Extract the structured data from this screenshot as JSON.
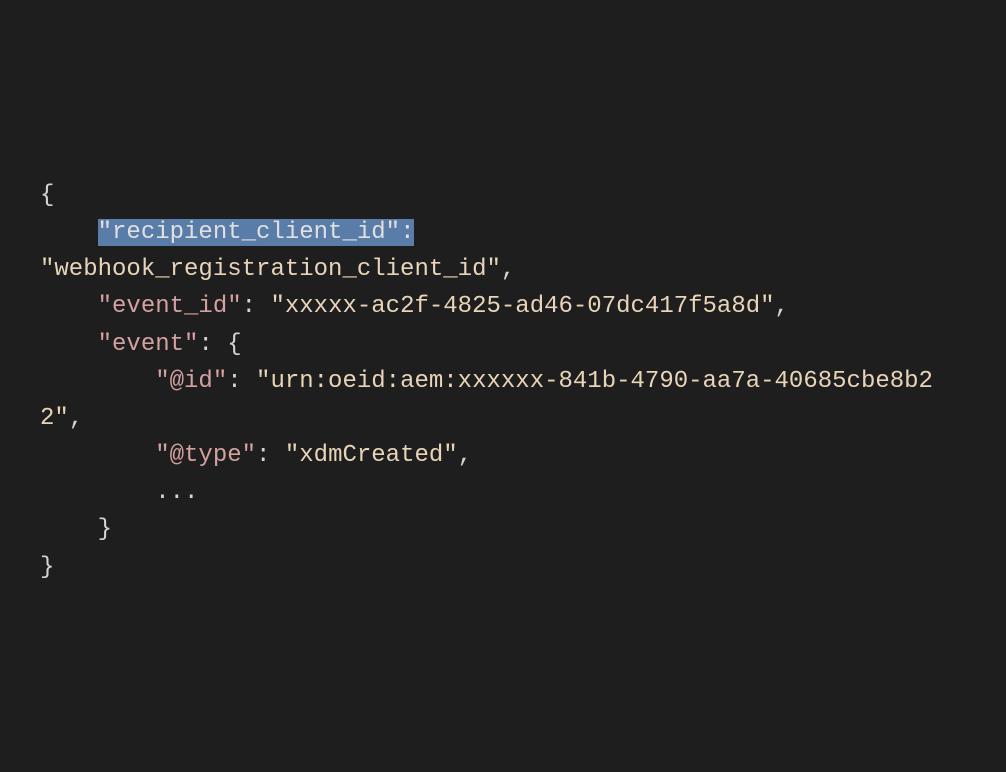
{
  "code": {
    "line1_brace": "{",
    "line2_indent": "    ",
    "line2_key_quote_open": "\"",
    "line2_key": "recipient_client_id",
    "line2_key_quote_close": "\"",
    "line2_colon": ":",
    "line3_value": "\"webhook_registration_client_id\"",
    "line3_comma": ",",
    "line4_indent": "    ",
    "line4_key": "\"event_id\"",
    "line4_colon": ": ",
    "line4_value": "\"xxxxx-ac2f-4825-ad46-07dc417f5a8d\"",
    "line4_comma": ",",
    "line6_indent": "    ",
    "line6_key": "\"event\"",
    "line6_colon": ": ",
    "line6_brace": "{",
    "line7_indent": "        ",
    "line7_key": "\"@id\"",
    "line7_colon": ": ",
    "line7_value": "\"urn:oeid:aem:xxxxxx-841b-4790-aa7a-40685cbe8b22\"",
    "line7_comma": ",",
    "line9_indent": "        ",
    "line9_key": "\"@type\"",
    "line9_colon": ": ",
    "line9_value": "\"xdmCreated\"",
    "line9_comma": ",",
    "line10_indent": "        ",
    "line10_dots": "...",
    "line11_indent": "    ",
    "line11_brace": "}",
    "line12_brace": "}"
  }
}
